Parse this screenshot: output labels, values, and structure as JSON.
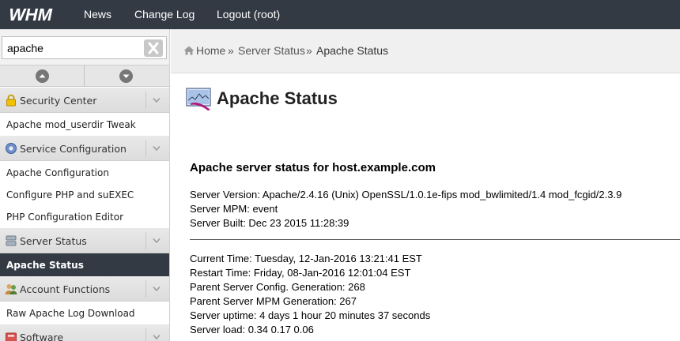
{
  "topbar": {
    "logo_text": "WHM",
    "nav": [
      "News",
      "Change Log",
      "Logout (root)"
    ]
  },
  "sidebar": {
    "search": {
      "value": "apache",
      "placeholder": ""
    },
    "categories": [
      {
        "label": "Security Center",
        "icon": "lock-icon",
        "items": [
          "Apache mod_userdir Tweak"
        ]
      },
      {
        "label": "Service Configuration",
        "icon": "gears-icon",
        "items": [
          "Apache Configuration",
          "Configure PHP and suEXEC",
          "PHP Configuration Editor"
        ]
      },
      {
        "label": "Server Status",
        "icon": "server-icon",
        "items": [
          "Apache Status"
        ]
      },
      {
        "label": "Account Functions",
        "icon": "users-icon",
        "items": [
          "Raw Apache Log Download"
        ]
      },
      {
        "label": "Software",
        "icon": "software-icon",
        "items": []
      }
    ],
    "active_item": "Apache Status"
  },
  "breadcrumb": {
    "home": "Home",
    "sep": "»",
    "parent": "Server Status",
    "current": "Apache Status"
  },
  "main": {
    "title": "Apache Status",
    "heading": "Apache server status for host.example.com",
    "server_info": [
      "Server Version: Apache/2.4.16 (Unix) OpenSSL/1.0.1e-fips mod_bwlimited/1.4 mod_fcgid/2.3.9",
      "Server MPM: event",
      "Server Built: Dec 23 2015 11:28:39"
    ],
    "status_info": [
      "Current Time: Tuesday, 12-Jan-2016 13:21:41 EST",
      "Restart Time: Friday, 08-Jan-2016 12:01:04 EST",
      "Parent Server Config. Generation: 268",
      "Parent Server MPM Generation: 267",
      "Server uptime: 4 days 1 hour 20 minutes 37 seconds",
      "Server load: 0.34 0.17 0.06"
    ]
  },
  "colors": {
    "topbar": "#333a44",
    "active_item": "#333a44"
  }
}
